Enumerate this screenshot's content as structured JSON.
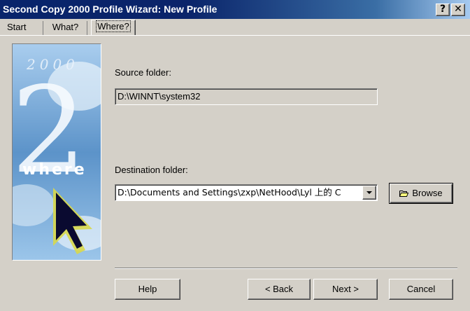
{
  "window": {
    "title": "Second Copy 2000 Profile Wizard: New Profile",
    "help_glyph": "?",
    "close_glyph": "✕"
  },
  "tabs": [
    {
      "label": "Start"
    },
    {
      "label": "What?"
    },
    {
      "label": "Where?"
    }
  ],
  "banner": {
    "year_text": "2000",
    "big_numeral": "2",
    "word": "where"
  },
  "source": {
    "label": "Source folder:",
    "value": "D:\\WINNT\\system32"
  },
  "destination": {
    "label": "Destination folder:",
    "value": "D:\\Documents and Settings\\zxp\\NetHood\\Lyl 上的 C"
  },
  "buttons": {
    "browse": "Browse",
    "help": "Help",
    "back": "< Back",
    "next": "Next >",
    "cancel": "Cancel"
  },
  "icons": {
    "browse": "folder-open-icon",
    "dropdown": "chevron-down-icon",
    "banner_cursor": "arrow-cursor-icon"
  }
}
